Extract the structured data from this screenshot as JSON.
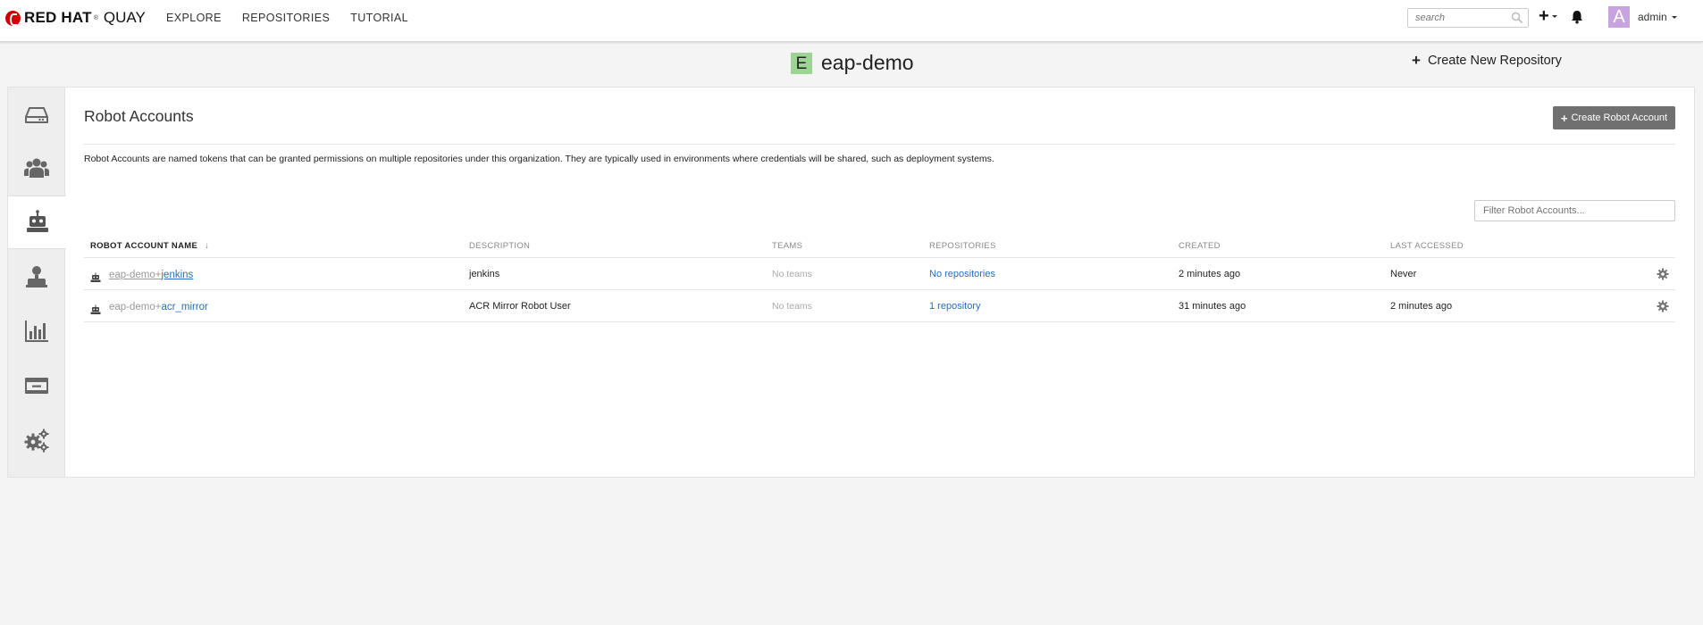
{
  "navbar": {
    "brand_red": "RED HAT",
    "brand_product": "QUAY",
    "links": [
      "EXPLORE",
      "REPOSITORIES",
      "TUTORIAL"
    ],
    "search_placeholder": "search",
    "user_avatar_letter": "A",
    "username": "admin"
  },
  "header": {
    "org_avatar_letter": "E",
    "org_name": "eap-demo",
    "create_repo_label": "Create New Repository"
  },
  "sidebar": {
    "tabs": [
      {
        "icon": "hard-drive-icon",
        "active": false
      },
      {
        "icon": "users-icon",
        "active": false
      },
      {
        "icon": "robot-icon",
        "active": true
      },
      {
        "icon": "user-permissions-icon",
        "active": false
      },
      {
        "icon": "bar-chart-icon",
        "active": false
      },
      {
        "icon": "credit-card-icon",
        "active": false
      },
      {
        "icon": "gears-icon",
        "active": false
      }
    ]
  },
  "robots": {
    "title": "Robot Accounts",
    "create_label": "Create Robot Account",
    "description": "Robot Accounts are named tokens that can be granted permissions on multiple repositories under this organization. They are typically used in environments where credentials will be shared, such as deployment systems.",
    "filter_placeholder": "Filter Robot Accounts...",
    "columns": {
      "name": "ROBOT ACCOUNT NAME",
      "description": "DESCRIPTION",
      "teams": "TEAMS",
      "repositories": "REPOSITORIES",
      "created": "CREATED",
      "last_accessed": "LAST ACCESSED"
    },
    "sort_arrow": "↓",
    "rows": [
      {
        "prefix": "eap-demo+",
        "shortname": "jenkins",
        "description": "jenkins",
        "teams": "No teams",
        "repositories": "No repositories",
        "created": "2 minutes ago",
        "last_accessed": "Never"
      },
      {
        "prefix": "eap-demo+",
        "shortname": "acr_mirror",
        "description": "ACR Mirror Robot User",
        "teams": "No teams",
        "repositories": "1 repository",
        "created": "31 minutes ago",
        "last_accessed": "2 minutes ago"
      }
    ]
  },
  "colors": {
    "link": "#2a6dc0",
    "brand_red": "#cc0000",
    "org_avatar": "#9bd493",
    "user_avatar": "#c7a4df",
    "button": "#707070"
  }
}
